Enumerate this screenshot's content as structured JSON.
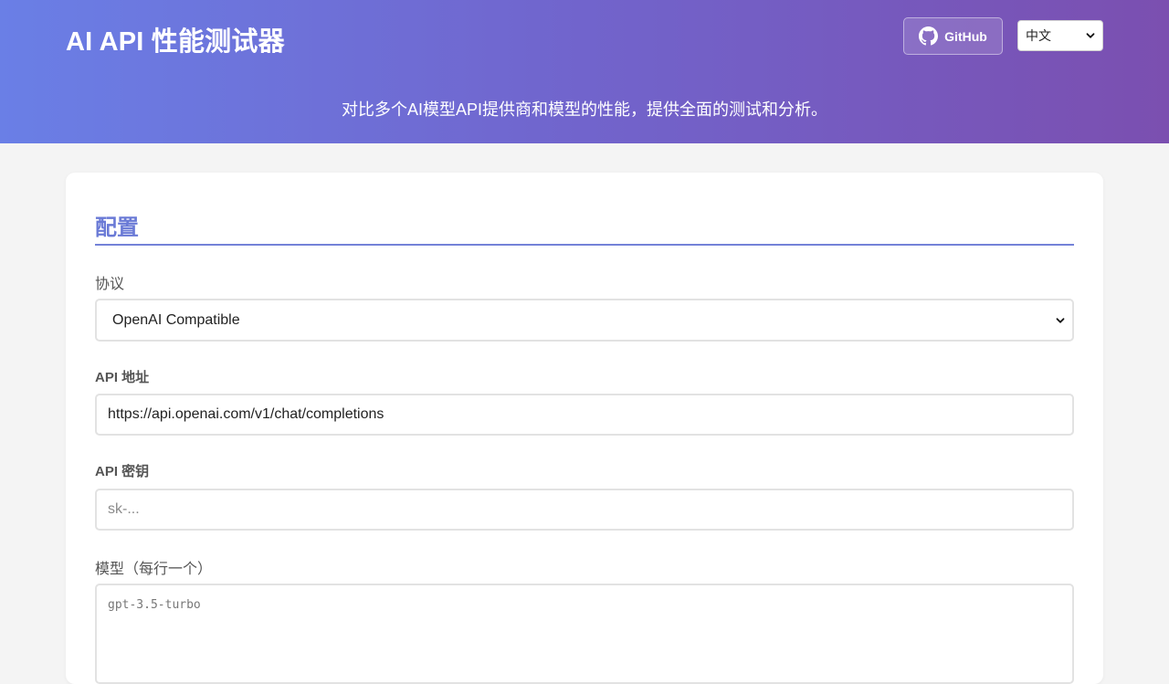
{
  "header": {
    "title": "AI API 性能测试器",
    "subtitle": "对比多个AI模型API提供商和模型的性能，提供全面的测试和分析。",
    "github_label": "GitHub",
    "language_selected": "中文"
  },
  "config": {
    "section_title": "配置",
    "protocol_label": "协议",
    "protocol_value": "OpenAI Compatible",
    "api_url_label": "API 地址",
    "api_url_value": "https://api.openai.com/v1/chat/completions",
    "api_key_label": "API 密钥",
    "api_key_placeholder": "sk-...",
    "models_label": "模型（每行一个）",
    "models_placeholder": "gpt-3.5-turbo"
  },
  "colors": {
    "header_gradient_start": "#6a7fe6",
    "header_gradient_end": "#7b4fb0",
    "accent": "#6a7ad6"
  },
  "icons": {
    "github": "github-icon",
    "select_arrow": "chevron-down-icon"
  }
}
